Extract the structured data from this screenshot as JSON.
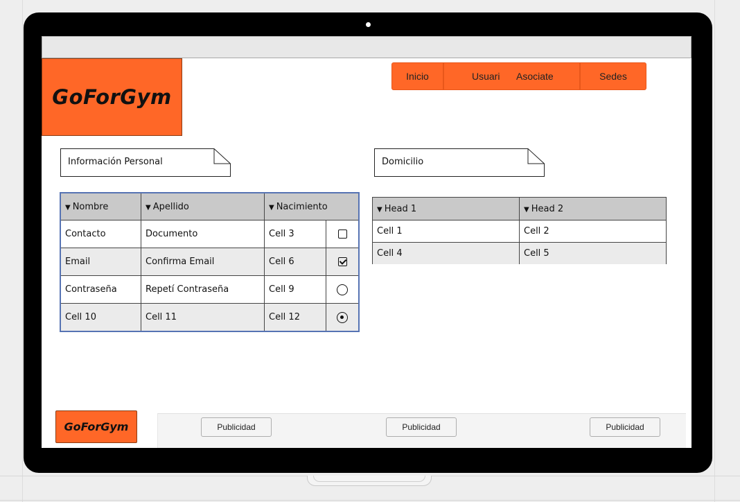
{
  "brand": {
    "name": "GoForGym",
    "accent_color": "#ff6727"
  },
  "nav": {
    "inicio": "Inicio",
    "usuario": "Usuari",
    "asociate": "Asociate",
    "sedes": "Sedes"
  },
  "personal": {
    "title": "Información Personal",
    "headers": [
      "Nombre",
      "Apellido",
      "Nacimiento"
    ],
    "rows": [
      [
        "Contacto",
        "Documento",
        "Cell 3"
      ],
      [
        "Email",
        "Confirma Email",
        "Cell 6"
      ],
      [
        "Contraseña",
        "Repetí Contraseña",
        "Cell 9"
      ],
      [
        "Cell 10",
        "Cell 11",
        "Cell 12"
      ]
    ],
    "controls": [
      "checkbox-unchecked",
      "checkbox-checked",
      "radio-unselected",
      "radio-selected"
    ]
  },
  "domicilio": {
    "title": "Domicilio",
    "headers": [
      "Head 1",
      "Head 2"
    ],
    "rows": [
      [
        "Cell 1",
        "Cell 2"
      ],
      [
        "Cell 4",
        "Cell 5"
      ]
    ]
  },
  "footer": {
    "logo": "GoForGym",
    "ads": [
      "Publicidad",
      "Publicidad",
      "Publicidad"
    ]
  }
}
